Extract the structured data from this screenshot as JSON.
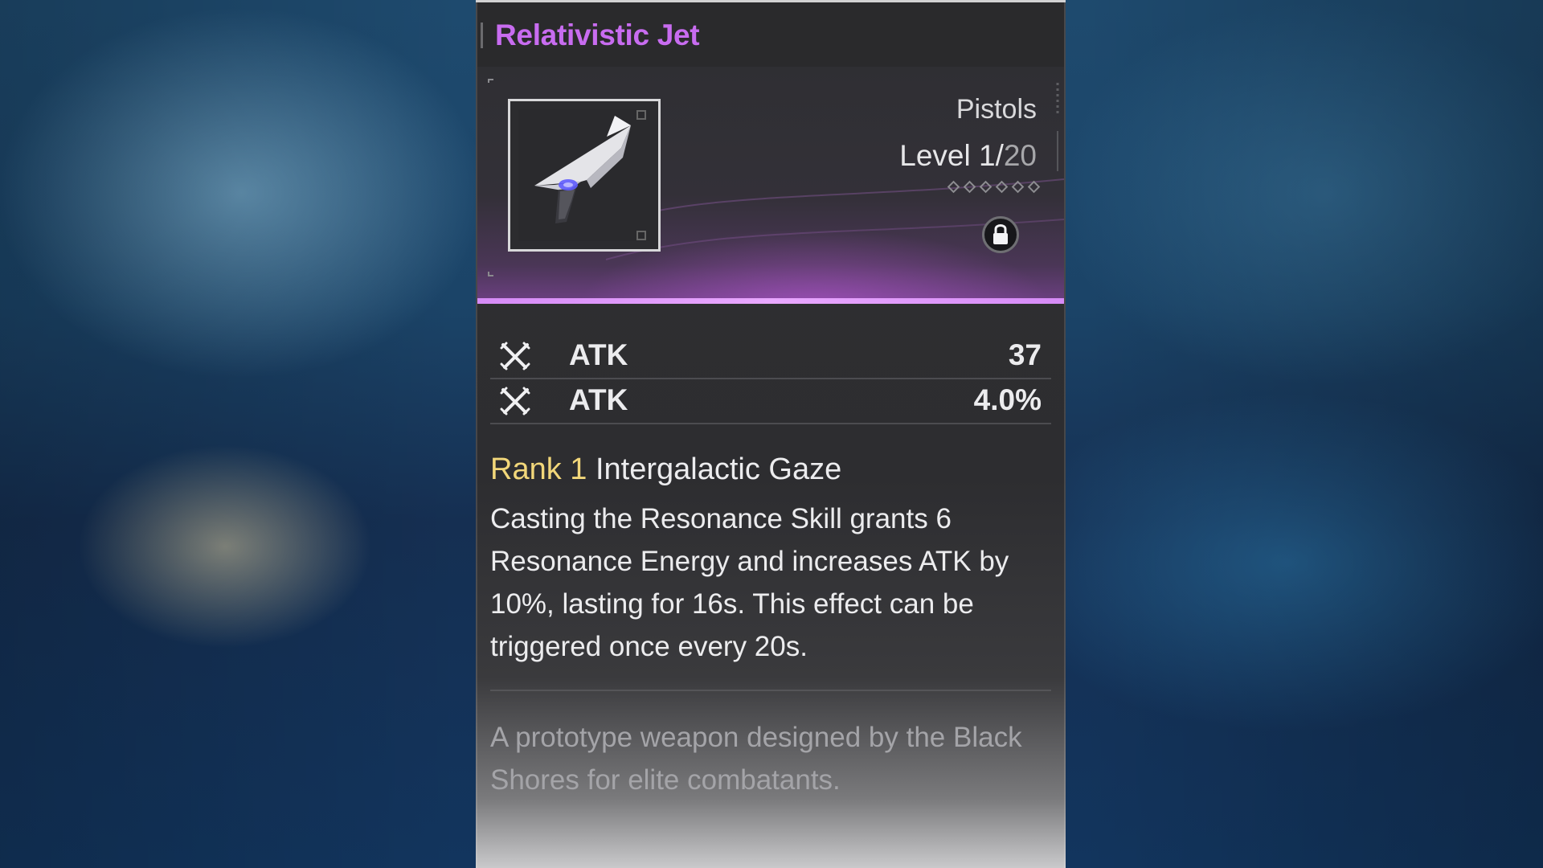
{
  "weapon": {
    "name": "Relativistic Jet",
    "type": "Pistols",
    "level_prefix": "Level",
    "level_current": "1",
    "level_separator": "/",
    "level_max": "20",
    "rank_icon": "diamond-icon",
    "lock_icon": "lock-icon",
    "image_icon": "pistol-icon"
  },
  "stats": [
    {
      "icon": "crossed-swords-icon",
      "label": "ATK",
      "value": "37"
    },
    {
      "icon": "crossed-swords-icon",
      "label": "ATK",
      "value": "4.0%"
    }
  ],
  "skill": {
    "rank": "Rank 1",
    "name": "Intergalactic Gaze",
    "description": "Casting the Resonance Skill grants 6 Resonance Energy and increases ATK by 10%, lasting for 16s. This effect can be triggered once every 20s."
  },
  "lore": "A prototype weapon designed by the Black Shores for elite combatants.",
  "colors": {
    "title": "#c86cf0",
    "rank": "#f2d77a",
    "accent_line": "#d68bf6"
  }
}
